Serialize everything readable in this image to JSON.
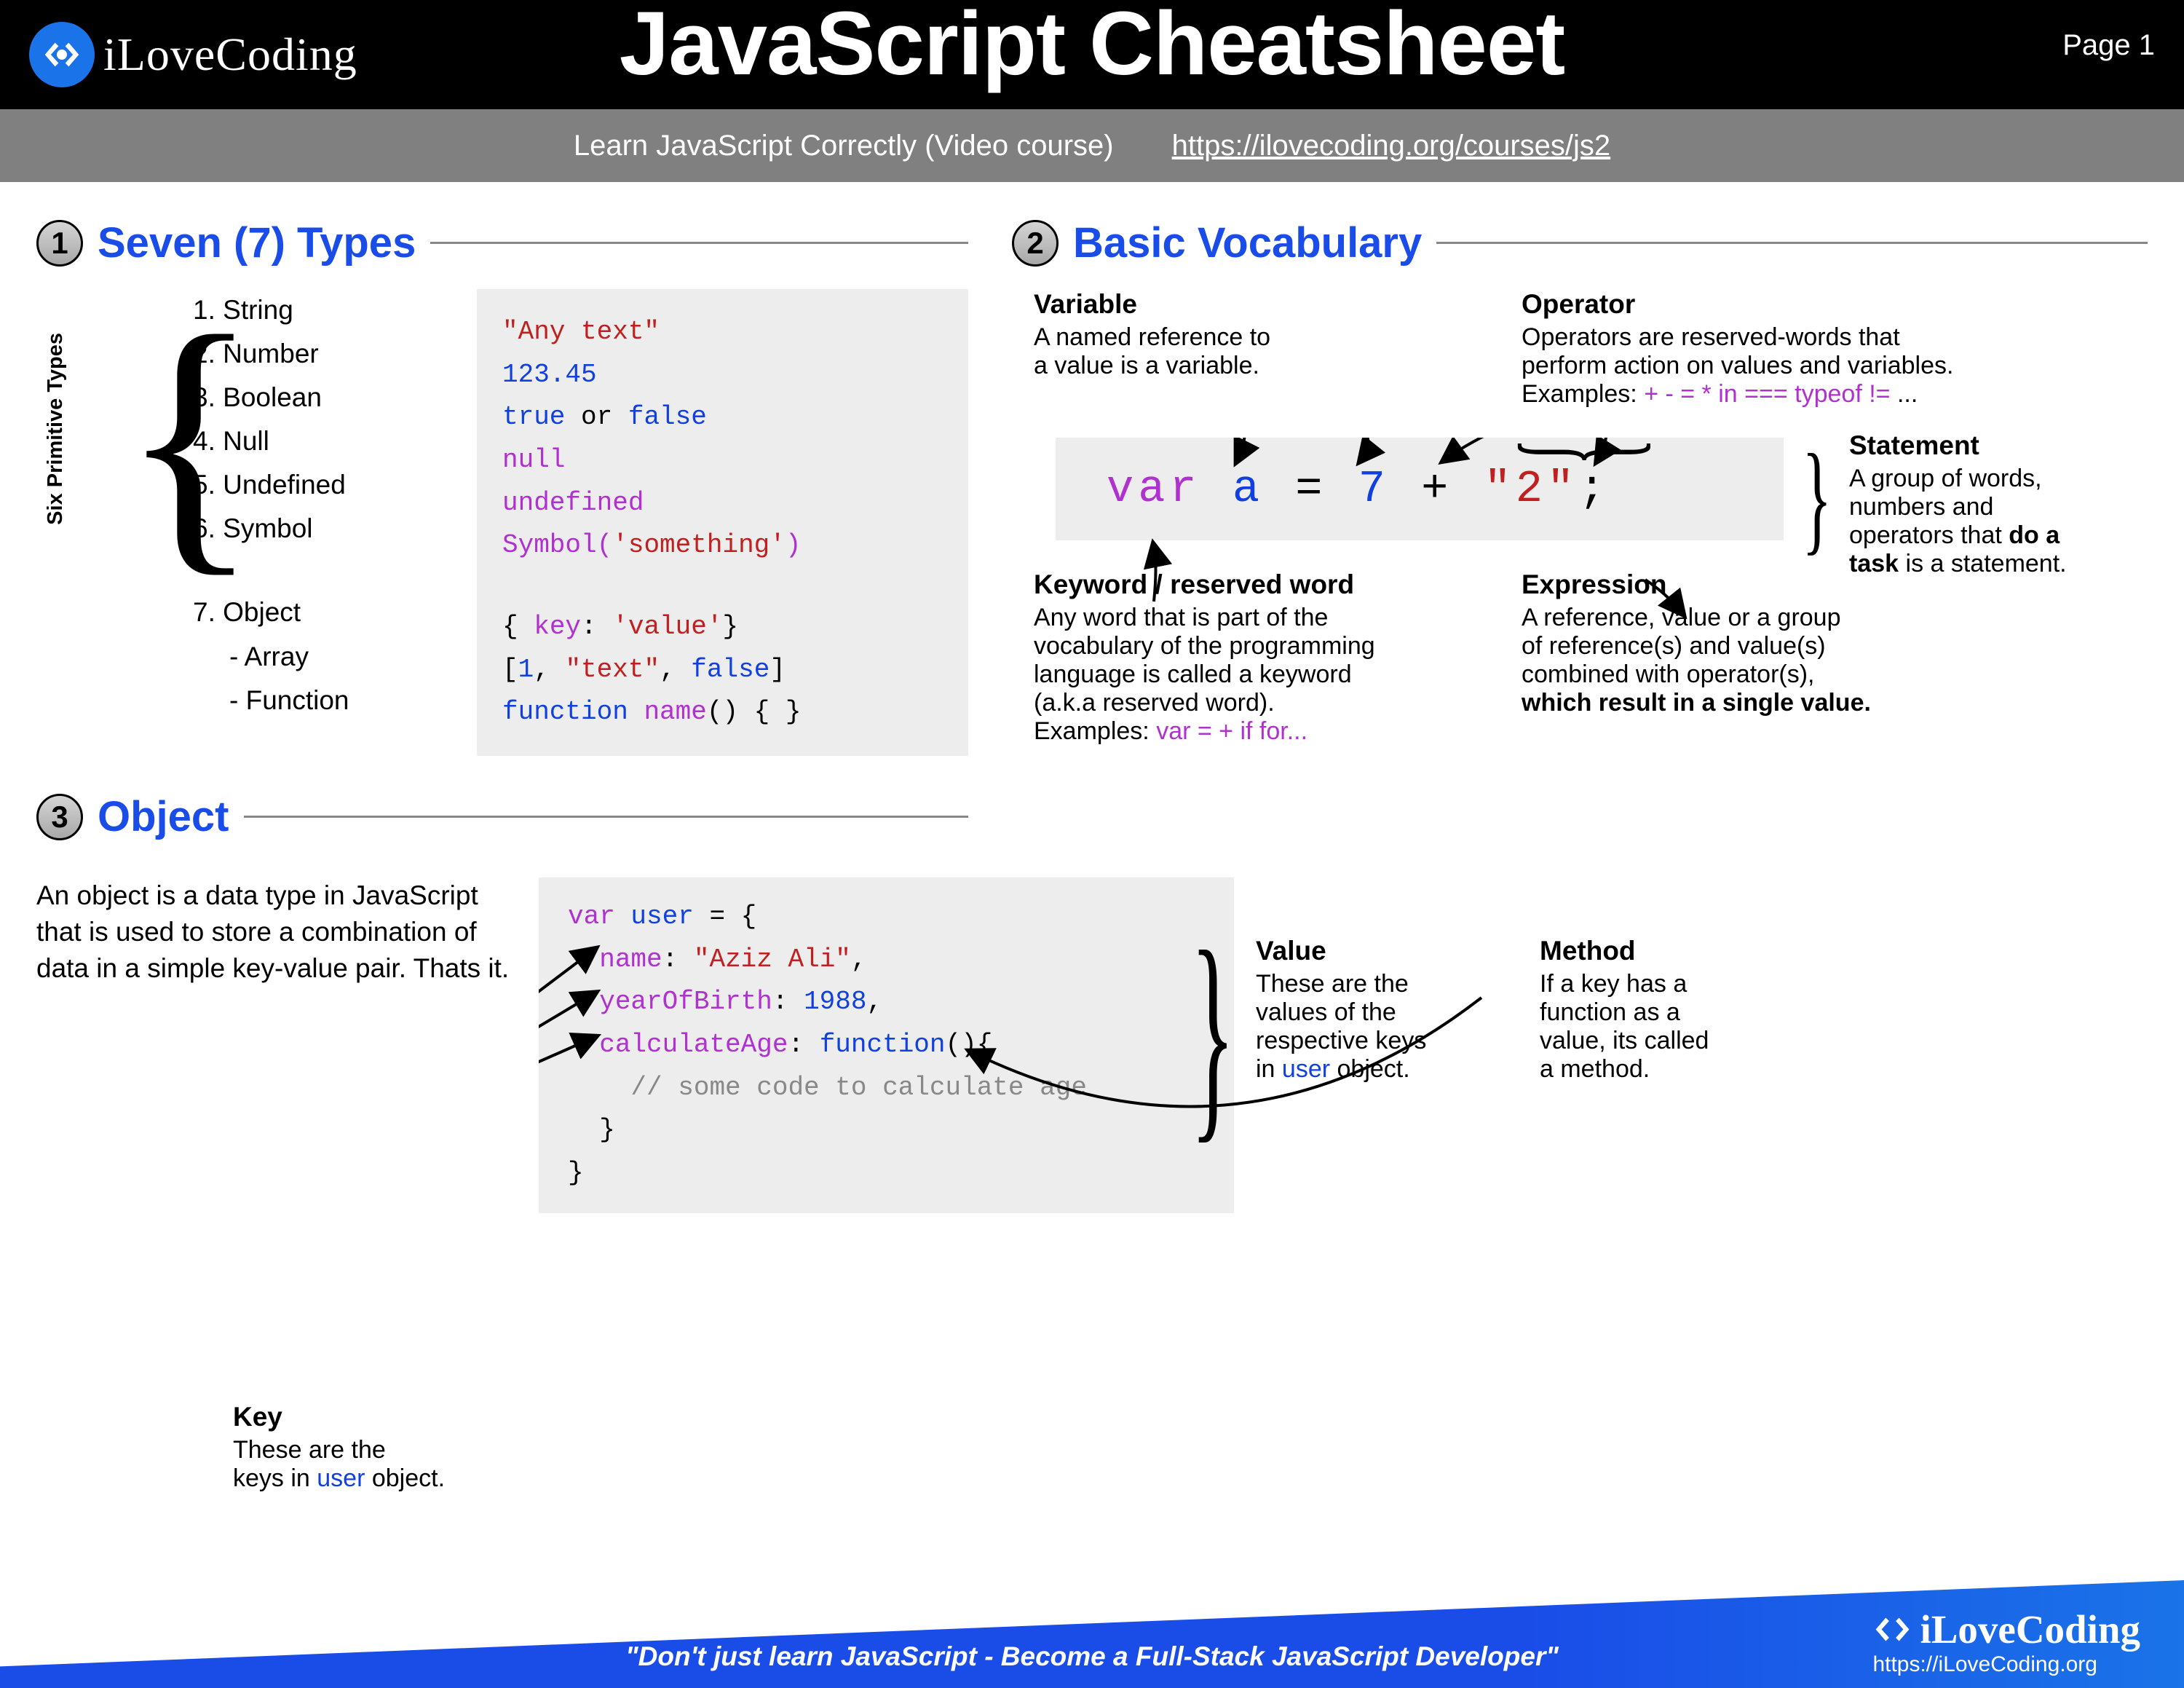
{
  "header": {
    "brand": "iLoveCoding",
    "title": "JavaScript Cheatsheet",
    "page": "Page 1",
    "subtitle": "Learn JavaScript Correctly (Video course)",
    "link": "https://ilovecoding.org/courses/js2"
  },
  "s1": {
    "num": "1",
    "title": "Seven (7) Types",
    "prim_label": "Six Primitive Types",
    "items": [
      "1.  String",
      "2.  Number",
      "3.  Boolean",
      "4.  Null",
      "5.  Undefined",
      "6.  Symbol",
      "7.  Object",
      "-  Array",
      "-  Function"
    ]
  },
  "s2": {
    "num": "2",
    "title": "Basic Vocabulary",
    "variable": {
      "t": "Variable",
      "d1": "A named reference to",
      "d2": "a value is a variable."
    },
    "operator": {
      "t": "Operator",
      "d1": "Operators are reserved-words that",
      "d2": "perform action on values and variables.",
      "ex": "Examples: "
    },
    "statement": {
      "t": "Statement",
      "d": "A group of words, numbers and operators that ",
      "d2": "do a task",
      "d3": " is a statement."
    },
    "keyword": {
      "t": "Keyword / reserved word",
      "d1": "Any word that is part of the",
      "d2": "vocabulary of the programming",
      "d3": "language is called a keyword",
      "d4": "(a.k.a reserved word).",
      "ex": "Examples: "
    },
    "expression": {
      "t": "Expression",
      "d1": "A reference, value or a group",
      "d2": "of reference(s) and value(s)",
      "d3": "combined with operator(s),",
      "d4": "which result in a single value."
    }
  },
  "s3": {
    "num": "3",
    "title": "Object",
    "desc": "An object is a data type in JavaScript that is used to store a combination of data in a simple key-value pair. Thats it.",
    "key": {
      "t": "Key",
      "d1": "These are the",
      "d2": "keys in ",
      "d3": " object."
    },
    "value": {
      "t": "Value",
      "d1": "These are the",
      "d2": "values of the",
      "d3": "respective keys",
      "d4": "in ",
      "d5": " object."
    },
    "method": {
      "t": "Method",
      "d1": "If a key has a",
      "d2": "function as a",
      "d3": "value, its called",
      "d4": "a method."
    }
  },
  "footer": {
    "quote": "\"Don't just learn JavaScript - Become a Full-Stack JavaScript Developer\"",
    "brand": "iLoveCoding",
    "url": "https://iLoveCoding.org"
  },
  "code": {
    "user_word": "user",
    "op_examples": "+ - = * in === typeof !=",
    "kw_examples": "var = + if for..."
  }
}
